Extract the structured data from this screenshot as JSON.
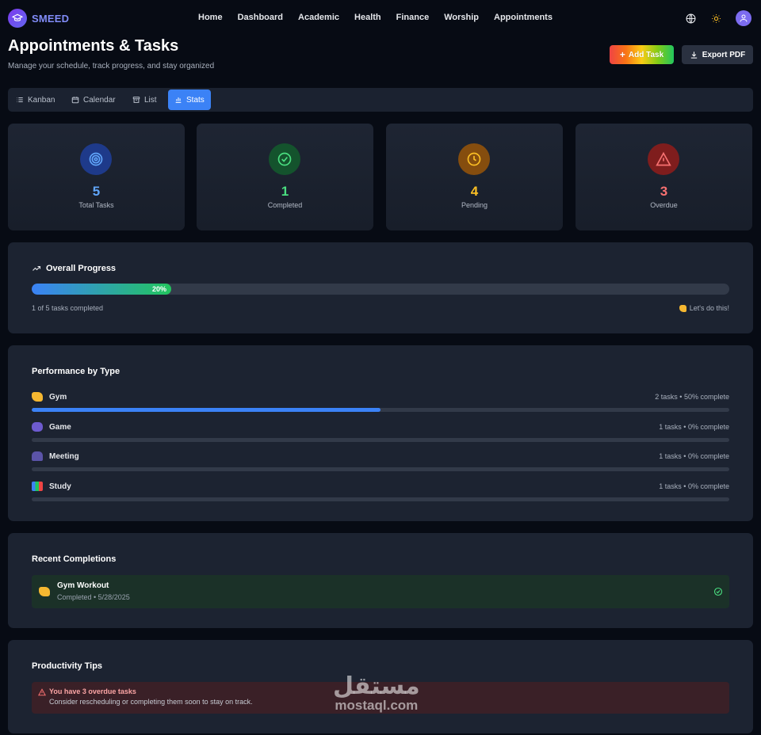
{
  "brand": {
    "name": "SMEED"
  },
  "nav": [
    "Home",
    "Dashboard",
    "Academic",
    "Health",
    "Finance",
    "Worship",
    "Appointments"
  ],
  "page": {
    "title": "Appointments & Tasks",
    "subtitle": "Manage your schedule, track progress, and stay organized",
    "add_label": "Add Task",
    "export_label": "Export PDF"
  },
  "tabs": [
    {
      "label": "Kanban",
      "icon": "list-icon"
    },
    {
      "label": "Calendar",
      "icon": "calendar-icon"
    },
    {
      "label": "List",
      "icon": "archive-icon"
    },
    {
      "label": "Stats",
      "icon": "bar-chart-icon",
      "active": true
    }
  ],
  "stats": [
    {
      "value": "5",
      "label": "Total Tasks",
      "icon": "target-icon",
      "color": "#60a5fa",
      "bg": "#1e3a8a"
    },
    {
      "value": "1",
      "label": "Completed",
      "icon": "check-circle-icon",
      "color": "#4ade80",
      "bg": "#14532d"
    },
    {
      "value": "4",
      "label": "Pending",
      "icon": "clock-icon",
      "color": "#fbbf24",
      "bg": "#854d0e"
    },
    {
      "value": "3",
      "label": "Overdue",
      "icon": "alert-triangle-icon",
      "color": "#f87171",
      "bg": "#7f1d1d"
    }
  ],
  "progress": {
    "title": "Overall Progress",
    "percent_label": "20%",
    "percent": 20,
    "caption": "1 of 5 tasks completed",
    "encourage": "Let's do this!"
  },
  "performance": {
    "title": "Performance by Type",
    "rows": [
      {
        "name": "Gym",
        "icon": "muscle-icon",
        "stat": "2 tasks • 50% complete",
        "percent": 50
      },
      {
        "name": "Game",
        "icon": "gamepad-icon",
        "stat": "1 tasks • 0% complete",
        "percent": 0
      },
      {
        "name": "Meeting",
        "icon": "people-icon",
        "stat": "1 tasks • 0% complete",
        "percent": 0
      },
      {
        "name": "Study",
        "icon": "books-icon",
        "stat": "1 tasks • 0% complete",
        "percent": 0
      }
    ]
  },
  "recent": {
    "title": "Recent Completions",
    "item_title": "Gym Workout",
    "item_meta": "Completed • 5/28/2025"
  },
  "tips": {
    "title": "Productivity Tips",
    "alert_title": "You have 3 overdue tasks",
    "alert_body": "Consider rescheduling or completing them soon to stay on track."
  },
  "watermark": {
    "arabic": "مستقل",
    "latin": "mostaql.com"
  }
}
